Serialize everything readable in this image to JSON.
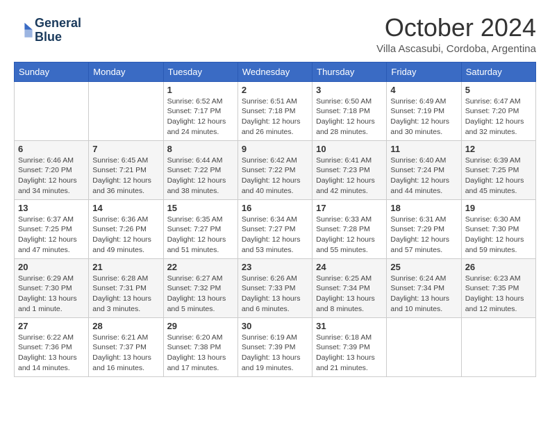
{
  "logo": {
    "line1": "General",
    "line2": "Blue"
  },
  "title": "October 2024",
  "location": "Villa Ascasubi, Cordoba, Argentina",
  "weekdays": [
    "Sunday",
    "Monday",
    "Tuesday",
    "Wednesday",
    "Thursday",
    "Friday",
    "Saturday"
  ],
  "weeks": [
    [
      {
        "day": "",
        "info": ""
      },
      {
        "day": "",
        "info": ""
      },
      {
        "day": "1",
        "info": "Sunrise: 6:52 AM\nSunset: 7:17 PM\nDaylight: 12 hours and 24 minutes."
      },
      {
        "day": "2",
        "info": "Sunrise: 6:51 AM\nSunset: 7:18 PM\nDaylight: 12 hours and 26 minutes."
      },
      {
        "day": "3",
        "info": "Sunrise: 6:50 AM\nSunset: 7:18 PM\nDaylight: 12 hours and 28 minutes."
      },
      {
        "day": "4",
        "info": "Sunrise: 6:49 AM\nSunset: 7:19 PM\nDaylight: 12 hours and 30 minutes."
      },
      {
        "day": "5",
        "info": "Sunrise: 6:47 AM\nSunset: 7:20 PM\nDaylight: 12 hours and 32 minutes."
      }
    ],
    [
      {
        "day": "6",
        "info": "Sunrise: 6:46 AM\nSunset: 7:20 PM\nDaylight: 12 hours and 34 minutes."
      },
      {
        "day": "7",
        "info": "Sunrise: 6:45 AM\nSunset: 7:21 PM\nDaylight: 12 hours and 36 minutes."
      },
      {
        "day": "8",
        "info": "Sunrise: 6:44 AM\nSunset: 7:22 PM\nDaylight: 12 hours and 38 minutes."
      },
      {
        "day": "9",
        "info": "Sunrise: 6:42 AM\nSunset: 7:22 PM\nDaylight: 12 hours and 40 minutes."
      },
      {
        "day": "10",
        "info": "Sunrise: 6:41 AM\nSunset: 7:23 PM\nDaylight: 12 hours and 42 minutes."
      },
      {
        "day": "11",
        "info": "Sunrise: 6:40 AM\nSunset: 7:24 PM\nDaylight: 12 hours and 44 minutes."
      },
      {
        "day": "12",
        "info": "Sunrise: 6:39 AM\nSunset: 7:25 PM\nDaylight: 12 hours and 45 minutes."
      }
    ],
    [
      {
        "day": "13",
        "info": "Sunrise: 6:37 AM\nSunset: 7:25 PM\nDaylight: 12 hours and 47 minutes."
      },
      {
        "day": "14",
        "info": "Sunrise: 6:36 AM\nSunset: 7:26 PM\nDaylight: 12 hours and 49 minutes."
      },
      {
        "day": "15",
        "info": "Sunrise: 6:35 AM\nSunset: 7:27 PM\nDaylight: 12 hours and 51 minutes."
      },
      {
        "day": "16",
        "info": "Sunrise: 6:34 AM\nSunset: 7:27 PM\nDaylight: 12 hours and 53 minutes."
      },
      {
        "day": "17",
        "info": "Sunrise: 6:33 AM\nSunset: 7:28 PM\nDaylight: 12 hours and 55 minutes."
      },
      {
        "day": "18",
        "info": "Sunrise: 6:31 AM\nSunset: 7:29 PM\nDaylight: 12 hours and 57 minutes."
      },
      {
        "day": "19",
        "info": "Sunrise: 6:30 AM\nSunset: 7:30 PM\nDaylight: 12 hours and 59 minutes."
      }
    ],
    [
      {
        "day": "20",
        "info": "Sunrise: 6:29 AM\nSunset: 7:30 PM\nDaylight: 13 hours and 1 minute."
      },
      {
        "day": "21",
        "info": "Sunrise: 6:28 AM\nSunset: 7:31 PM\nDaylight: 13 hours and 3 minutes."
      },
      {
        "day": "22",
        "info": "Sunrise: 6:27 AM\nSunset: 7:32 PM\nDaylight: 13 hours and 5 minutes."
      },
      {
        "day": "23",
        "info": "Sunrise: 6:26 AM\nSunset: 7:33 PM\nDaylight: 13 hours and 6 minutes."
      },
      {
        "day": "24",
        "info": "Sunrise: 6:25 AM\nSunset: 7:34 PM\nDaylight: 13 hours and 8 minutes."
      },
      {
        "day": "25",
        "info": "Sunrise: 6:24 AM\nSunset: 7:34 PM\nDaylight: 13 hours and 10 minutes."
      },
      {
        "day": "26",
        "info": "Sunrise: 6:23 AM\nSunset: 7:35 PM\nDaylight: 13 hours and 12 minutes."
      }
    ],
    [
      {
        "day": "27",
        "info": "Sunrise: 6:22 AM\nSunset: 7:36 PM\nDaylight: 13 hours and 14 minutes."
      },
      {
        "day": "28",
        "info": "Sunrise: 6:21 AM\nSunset: 7:37 PM\nDaylight: 13 hours and 16 minutes."
      },
      {
        "day": "29",
        "info": "Sunrise: 6:20 AM\nSunset: 7:38 PM\nDaylight: 13 hours and 17 minutes."
      },
      {
        "day": "30",
        "info": "Sunrise: 6:19 AM\nSunset: 7:39 PM\nDaylight: 13 hours and 19 minutes."
      },
      {
        "day": "31",
        "info": "Sunrise: 6:18 AM\nSunset: 7:39 PM\nDaylight: 13 hours and 21 minutes."
      },
      {
        "day": "",
        "info": ""
      },
      {
        "day": "",
        "info": ""
      }
    ]
  ]
}
